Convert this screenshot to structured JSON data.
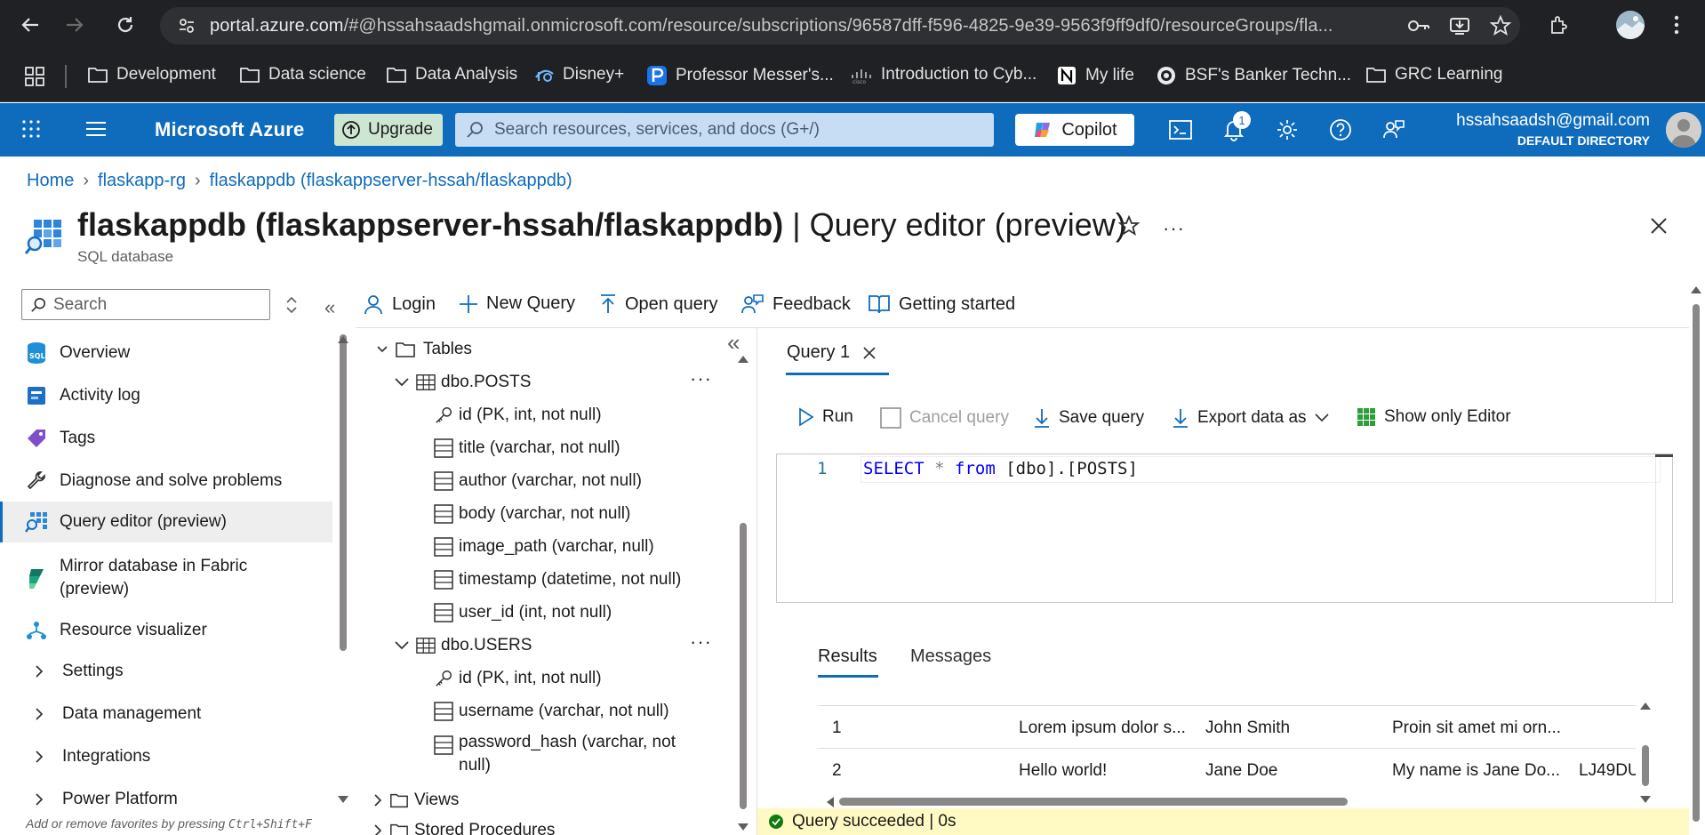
{
  "browser": {
    "url_host": "portal.azure.com",
    "url_path": "/#@hssahsaadshgmail.onmicrosoft.com/resource/subscriptions/96587dff-f596-4825-9e39-9563f9ff9df0/resourceGroups/fla...",
    "bookmarks": [
      {
        "label": "Development",
        "icon": "folder-icon"
      },
      {
        "label": "Data science",
        "icon": "folder-icon"
      },
      {
        "label": "Data Analysis",
        "icon": "folder-icon"
      },
      {
        "label": "Disney+",
        "icon": "disney-icon"
      },
      {
        "label": "Professor Messer's...",
        "icon": "professor-messer-icon"
      },
      {
        "label": "Introduction to Cyb...",
        "icon": "cisco-icon"
      },
      {
        "label": "My life",
        "icon": "notion-icon"
      },
      {
        "label": "BSF's Banker Techn...",
        "icon": "bsf-icon"
      },
      {
        "label": "GRC Learning",
        "icon": "folder-icon"
      }
    ]
  },
  "azure_header": {
    "title": "Microsoft Azure",
    "upgrade_label": "Upgrade",
    "search_placeholder": "Search resources, services, and docs (G+/)",
    "copilot_label": "Copilot",
    "notification_count": "1",
    "user_email": "hssahsaadsh@gmail.com",
    "user_directory": "DEFAULT DIRECTORY"
  },
  "breadcrumb": {
    "items": [
      "Home",
      "flaskapp-rg",
      "flaskappdb (flaskappserver-hssah/flaskappdb)"
    ]
  },
  "page": {
    "title_bold": "flaskappdb (flaskappserver-hssah/flaskappdb)",
    "title_light": " | Query editor (preview)",
    "subtitle": "SQL database"
  },
  "left_nav": {
    "search_placeholder": "Search",
    "items": [
      {
        "label": "Overview",
        "icon": "sql-icon"
      },
      {
        "label": "Activity log",
        "icon": "activity-log-icon"
      },
      {
        "label": "Tags",
        "icon": "tag-icon"
      },
      {
        "label": "Diagnose and solve problems",
        "icon": "wrench-icon"
      },
      {
        "label": "Query editor (preview)",
        "icon": "query-editor-icon",
        "active": true
      },
      {
        "label": "Mirror database in Fabric",
        "label2": "(preview)",
        "icon": "fabric-icon"
      },
      {
        "label": "Resource visualizer",
        "icon": "resource-visualizer-icon"
      },
      {
        "label": "Settings",
        "expandable": true
      },
      {
        "label": "Data management",
        "expandable": true
      },
      {
        "label": "Integrations",
        "expandable": true
      },
      {
        "label": "Power Platform",
        "expandable": true
      }
    ],
    "footer_hint_prefix": "Add or remove favorites by pressing ",
    "footer_hint_keys": "Ctrl+Shift+F"
  },
  "toolbar": {
    "login": "Login",
    "new_query": "New Query",
    "open_query": "Open query",
    "feedback": "Feedback",
    "getting_started": "Getting started"
  },
  "tree": {
    "tables_label": "Tables",
    "posts": {
      "name": "dbo.POSTS",
      "columns": [
        {
          "label": "id (PK, int, not null)",
          "key": true
        },
        {
          "label": "title (varchar, not null)"
        },
        {
          "label": "author (varchar, not null)"
        },
        {
          "label": "body (varchar, not null)"
        },
        {
          "label": "image_path (varchar, null)"
        },
        {
          "label": "timestamp (datetime, not null)"
        },
        {
          "label": "user_id (int, not null)"
        }
      ]
    },
    "users": {
      "name": "dbo.USERS",
      "columns": [
        {
          "label": "id (PK, int, not null)",
          "key": true
        },
        {
          "label": "username (varchar, not null)"
        },
        {
          "label": "password_hash (varchar, not",
          "label2": "null)"
        }
      ]
    },
    "views_label": "Views",
    "procedures_label": "Stored Procedures"
  },
  "query": {
    "tab_label": "Query 1",
    "run": "Run",
    "cancel": "Cancel query",
    "save": "Save query",
    "export": "Export data as",
    "show_editor": "Show only Editor",
    "line_number": "1",
    "code": {
      "select": "SELECT",
      "star": "*",
      "from": "from",
      "target": "[dbo].[POSTS]"
    }
  },
  "results": {
    "tabs": [
      "Results",
      "Messages"
    ],
    "rows": [
      [
        "1",
        "Lorem ipsum dolor s...",
        "John Smith",
        "Proin sit amet mi orn...",
        ""
      ],
      [
        "2",
        "Hello world!",
        "Jane Doe",
        "My name is Jane Do...",
        "LJ49DU"
      ]
    ],
    "status": "Query succeeded | 0s"
  },
  "colors": {
    "azure_blue": "#0f6cbd",
    "chrome_dark": "#202124",
    "success_green": "#107c10"
  }
}
